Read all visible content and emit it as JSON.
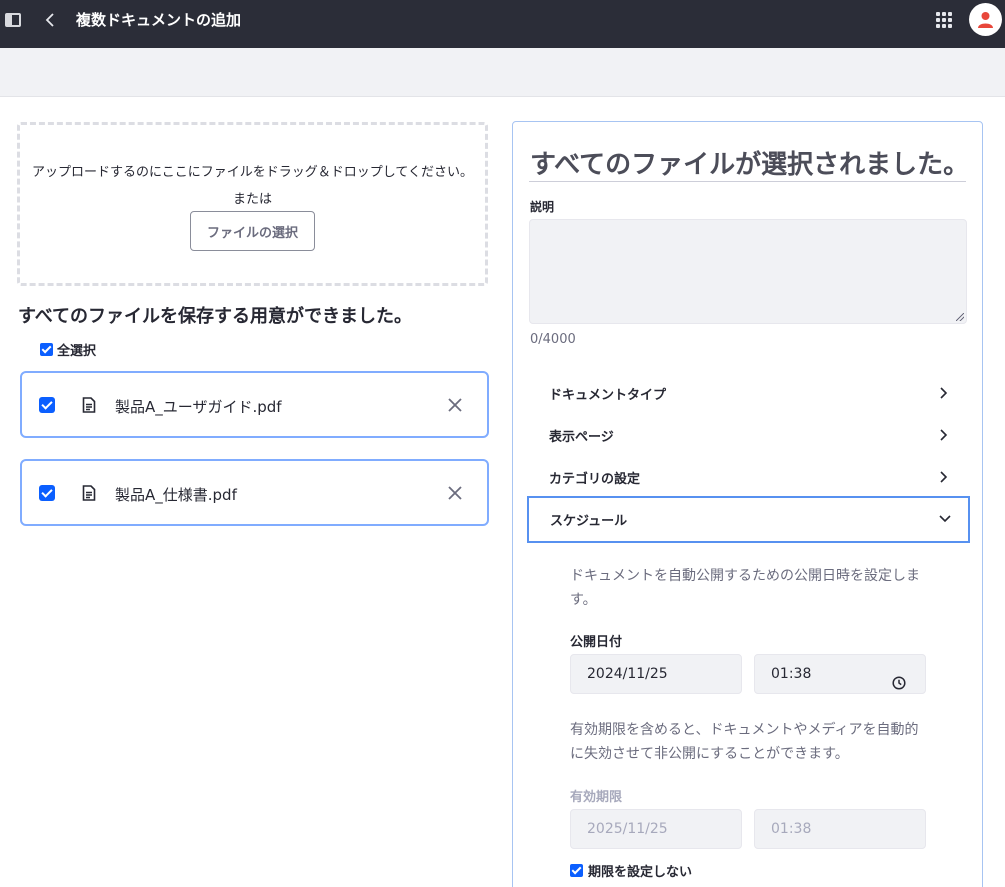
{
  "topbar": {
    "title": "複数ドキュメントの追加",
    "icons": [
      "sidebar-toggle-icon",
      "back-chevron-icon",
      "apps-grid-icon",
      "user-avatar-icon"
    ]
  },
  "dropzone": {
    "message": "アップロードするのにここにファイルをドラッグ＆ドロップしてください。",
    "or": "または",
    "select_button": "ファイルの選択"
  },
  "files_section": {
    "title": "すべてのファイルを保存する用意ができました。",
    "select_all": "全選択",
    "files": [
      {
        "name": "製品A_ユーザガイド.pdf",
        "checked": true
      },
      {
        "name": "製品A_仕様書.pdf",
        "checked": true
      }
    ]
  },
  "panel": {
    "heading": "すべてのファイルが選択されました。",
    "description_label": "説明",
    "description_value": "",
    "counter": "0/4000",
    "accordion": [
      {
        "label": "ドキュメントタイプ",
        "expanded": false
      },
      {
        "label": "表示ページ",
        "expanded": false
      },
      {
        "label": "カテゴリの設定",
        "expanded": false
      },
      {
        "label": "スケジュール",
        "expanded": true
      }
    ],
    "schedule": {
      "intro": "ドキュメントを自動公開するための公開日時を設定します。",
      "publish_date_label": "公開日付",
      "publish_date": "2024/11/25",
      "publish_time": "01:38",
      "expiry_intro": "有効期限を含めると、ドキュメントやメディアを自動的に失効させて非公開にすることができます。",
      "expiry_label": "有効期限",
      "expiry_date": "2025/11/25",
      "expiry_time": "01:38",
      "no_expiry_label": "期限を設定しない",
      "no_expiry_checked": true
    }
  },
  "colors": {
    "topbar": "#2b2d38",
    "accent": "#0b5fff",
    "card_border": "#80acff",
    "panel_border": "#a7c4f2"
  }
}
